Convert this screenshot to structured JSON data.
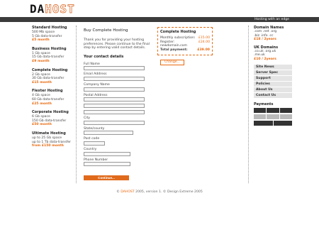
{
  "header": {
    "logo_dark": "DA",
    "logo_light": "HOST",
    "tagline": "Hosting with an edge"
  },
  "plans": [
    {
      "title": "Standard Hosting",
      "space": "500 Mb space",
      "transfer": "5 Gb data-transfer",
      "price": "£5 month"
    },
    {
      "title": "Business Hosting",
      "space": "1 Gb space",
      "transfer": "15 Gb data-transfer",
      "price": "£9 month"
    },
    {
      "title": "Complete Hosting",
      "space": "2 Gb space",
      "transfer": "30 Gb data-transfer",
      "price": "£15 month"
    },
    {
      "title": "Flexter Hosting",
      "space": "4 Gb space",
      "transfer": "60 Gb data-transfer",
      "price": "£25 month"
    },
    {
      "title": "Corporate Hosting",
      "space": "6 Gb space",
      "transfer": "150 Gb data-transfer",
      "price": "£50 month"
    },
    {
      "title": "Ultimate Hosting",
      "space": "up to 25 Gb space",
      "transfer": "up to 1 Tb data-transfer",
      "price": "from £150 month"
    }
  ],
  "main": {
    "heading": "Buy Complete Hosting",
    "intro": "Thank you for providing your hosting preferences. Please continue to the final step by entering valid contact details.",
    "contact_heading": "Your contact details",
    "fields": [
      {
        "label": "Full Name"
      },
      {
        "label": "Email Address"
      },
      {
        "label": "Company Name"
      },
      {
        "label": "Postal Address"
      },
      {
        "label": "City"
      },
      {
        "label": "State/county"
      },
      {
        "label": "Post code"
      },
      {
        "label": "Country"
      },
      {
        "label": "Phone Number"
      }
    ],
    "continue_label": "Continue..."
  },
  "order": {
    "title": "Complete Hosting",
    "rows": [
      {
        "label": "Monthly subscription:",
        "price": "£15.00"
      },
      {
        "label": "Register: newdomain.com",
        "price": "£24.00"
      }
    ],
    "total_label": "Total payment:",
    "total_price": "£39.00",
    "change_label": "Change..."
  },
  "sidebar": {
    "domain_names_title": "Domain Names",
    "domain_names_line1": ".com .net .org",
    "domain_names_line2": ".biz .info .cc",
    "domain_names_price": "£18 / 2years",
    "uk_title": "UK Domains",
    "uk_line1": ".co.uk .org.uk",
    "uk_line2": ".me.uk",
    "uk_price": "£10 / 2years",
    "nav": [
      "Site News",
      "Server Spec",
      "Support",
      "Policies",
      "About Us",
      "Contact Us"
    ],
    "payments_title": "Payments"
  },
  "footer": {
    "copy_prefix": "© ",
    "brand": "DAHOST",
    "text": " 2005, version 1. © Design Extreme 2005"
  },
  "colors": {
    "accent": "#e86a10",
    "topbar": "#3b3b3b"
  }
}
